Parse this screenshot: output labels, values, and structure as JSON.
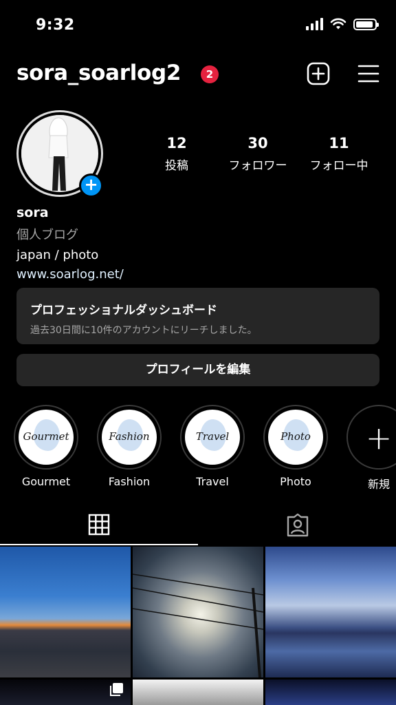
{
  "status_bar": {
    "time": "9:32"
  },
  "header": {
    "username": "sora_soarlog2",
    "notification_count": "2"
  },
  "profile": {
    "stats": [
      {
        "value": "12",
        "label": "投稿"
      },
      {
        "value": "30",
        "label": "フォロワー"
      },
      {
        "value": "11",
        "label": "フォロー中"
      }
    ],
    "name": "sora",
    "category": "個人ブログ",
    "bio": "japan / photo",
    "link": "www.soarlog.net/"
  },
  "dashboard": {
    "title": "プロフェッショナルダッシュボード",
    "subtitle": "過去30日間に10件のアカウントにリーチしました。"
  },
  "edit_profile_label": "プロフィールを編集",
  "highlights": [
    {
      "label": "Gourmet",
      "script": "Gourmet"
    },
    {
      "label": "Fashion",
      "script": "Fashion"
    },
    {
      "label": "Travel",
      "script": "Travel"
    },
    {
      "label": "Photo",
      "script": "Photo"
    },
    {
      "label": "新規"
    }
  ],
  "icons": {
    "add_post": "plus-square-icon",
    "menu": "hamburger-menu-icon",
    "grid_tab": "grid-icon",
    "tagged_tab": "tagged-person-icon",
    "multi_photo": "carousel-icon"
  },
  "colors": {
    "accent_blue": "#0095f6",
    "badge_red": "#e5223f",
    "card_bg": "#262626"
  }
}
